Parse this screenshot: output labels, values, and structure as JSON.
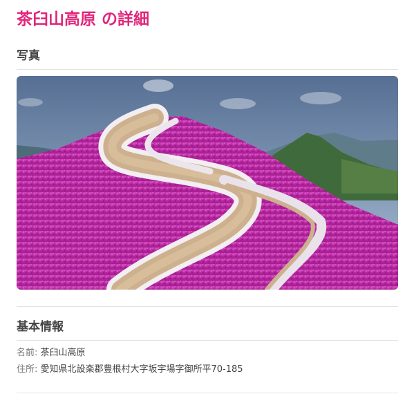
{
  "page": {
    "title": "茶臼山高原 の詳細"
  },
  "photo_section": {
    "heading": "写真",
    "image_subject": "mountain-hill-covered-with-pink-moss-phlox-and-winding-path"
  },
  "basic_info": {
    "heading": "基本情報",
    "name_label": "名前: ",
    "name_value": "茶臼山高原",
    "address_label": "住所: ",
    "address_value": "愛知県北設楽郡豊根村大字坂宇場字御所平70-185"
  },
  "colors": {
    "accent": "#e0267a",
    "heading": "#444444",
    "divider": "#e3e3e3"
  }
}
